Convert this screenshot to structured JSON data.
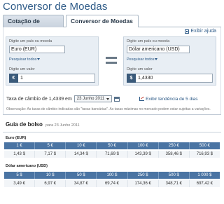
{
  "page": {
    "title": "Conversor de Moedas"
  },
  "tabs": [
    {
      "label": "Cotação de Moedas"
    },
    {
      "label": "Conversor de Moedas"
    }
  ],
  "help": {
    "label": "Exibir ajuda"
  },
  "from": {
    "select_label": "Digite um país ou moeda",
    "currency": "Euro (EUR)",
    "search_label": "Pesquisar todos",
    "amount_label": "Digite um valor",
    "symbol": "€",
    "amount": "1"
  },
  "to": {
    "select_label": "Digite um país ou moeda",
    "currency": "Dólar americano (USD)",
    "search_label": "Pesquisar todos",
    "amount_label": "Digite um valor",
    "symbol": "$",
    "amount": "1,4330"
  },
  "rate": {
    "label": "Taxa de câmbio de 1,4339 em",
    "date": "23 Junho 2011",
    "trend_label": "Exibir tendência de 5 dias"
  },
  "observation": "Observação: As taxas de câmbio indicadas são \"taxas bancárias\". As taxas máximas no mercado podem estar sujeitas a variações.",
  "guide": {
    "title": "Guia de bolso",
    "subtitle": "para 23 Junho 2011",
    "tables": [
      {
        "currency": "Euro (EUR)",
        "headers": [
          "1 €",
          "5 €",
          "10 €",
          "50 €",
          "100 €",
          "250 €",
          "500 €"
        ],
        "values": [
          "1,43 $",
          "7,17 $",
          "14,34 $",
          "71,69 $",
          "143,39 $",
          "358,46 $",
          "716,93 $"
        ]
      },
      {
        "currency": "Dólar americano (USD)",
        "headers": [
          "5 $",
          "10 $",
          "50 $",
          "100 $",
          "250 $",
          "500 $",
          "1 000 $"
        ],
        "values": [
          "3,49 €",
          "6,97 €",
          "34,87 €",
          "69,74 €",
          "174,36 €",
          "348,71 €",
          "697,42 €"
        ]
      }
    ]
  },
  "colors": {
    "accent": "#2d5a87",
    "table_header": "#4a74a3",
    "input_box_bg": "#e8eef4"
  }
}
